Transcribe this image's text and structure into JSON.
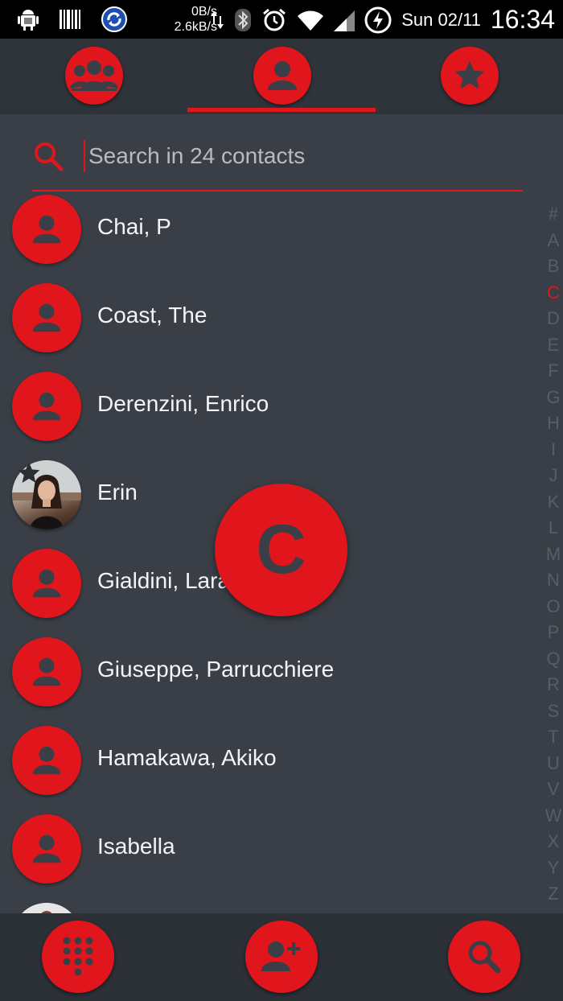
{
  "status_bar": {
    "net_up": "0B/s",
    "net_down": "2.6kB/s",
    "date": "Sun 02/11",
    "time": "16:34"
  },
  "tabs": [
    {
      "icon": "groups-icon"
    },
    {
      "icon": "person-icon",
      "selected": true
    },
    {
      "icon": "star-icon"
    }
  ],
  "search": {
    "placeholder": "Search in 24 contacts"
  },
  "contacts": [
    {
      "name": "Chai, P",
      "avatar": "default"
    },
    {
      "name": "Coast, The",
      "avatar": "default"
    },
    {
      "name": "Derenzini, Enrico",
      "avatar": "default"
    },
    {
      "name": "Erin",
      "avatar": "photo",
      "favorite": true
    },
    {
      "name": "Gialdini, Lara",
      "avatar": "default"
    },
    {
      "name": "Giuseppe, Parrucchiere",
      "avatar": "default"
    },
    {
      "name": "Hamakawa, Akiko",
      "avatar": "default"
    },
    {
      "name": "Isabella",
      "avatar": "default"
    }
  ],
  "alpha_index": [
    "#",
    "A",
    "B",
    "C",
    "D",
    "E",
    "F",
    "G",
    "H",
    "I",
    "J",
    "K",
    "L",
    "M",
    "N",
    "O",
    "P",
    "Q",
    "R",
    "S",
    "T",
    "U",
    "V",
    "W",
    "X",
    "Y",
    "Z"
  ],
  "alpha_active": "C",
  "fast_scroll_letter": "C",
  "colors": {
    "accent": "#e0161c",
    "background": "#3a3f47",
    "bar": "#2f343b"
  }
}
